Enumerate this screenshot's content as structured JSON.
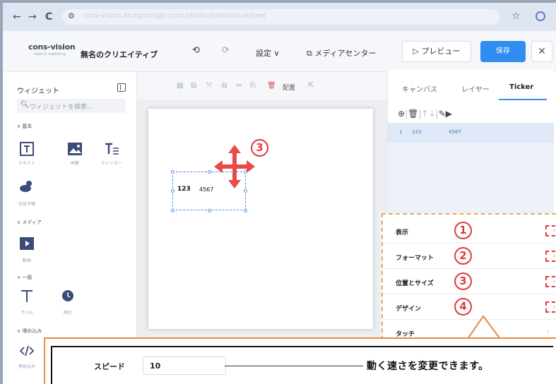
{
  "browser": {
    "nav_back": "←",
    "nav_forward": "→",
    "nav_reload": "C",
    "url": "cons-vision.imagemagic.com/studio/interactive/new"
  },
  "header": {
    "logo_text": "cons-vision",
    "logo_sub": "sales & marketing",
    "project_title": "無名のクリエイティブ",
    "undo": "⟲",
    "redo": "⟳",
    "settings_label": "設定 ∨",
    "media_center_label": "メディアセンター",
    "preview_label": "▷ プレビュー",
    "save_label": "保存",
    "close_label": "✕"
  },
  "sidebar": {
    "title": "ウィジェット",
    "search_placeholder": "ウィジェットを検索...",
    "sections": {
      "basic": "∨ 基本",
      "media": "∨ メディア",
      "general": "∨ 一般",
      "embed": "∨ 埋め込み"
    },
    "widgets": {
      "text": "テキスト",
      "image": "画像",
      "ticker": "ティッカー",
      "weather": "天気予報",
      "video": "動画",
      "label": "ラベル",
      "clock": "時計",
      "embed": "埋め込み"
    }
  },
  "toolbar": {
    "arrange_label": "配置"
  },
  "canvas": {
    "ticker_num": "123",
    "ticker_text": "4567",
    "annotation_move": "3"
  },
  "right_panel": {
    "tabs": [
      "キャンバス",
      "レイヤー",
      "Ticker"
    ],
    "active_tab": "Ticker",
    "row": {
      "index": "1",
      "col1": "123",
      "col2": "4567"
    }
  },
  "props": {
    "rows": [
      {
        "label": "表示",
        "num": "1"
      },
      {
        "label": "フォーマット",
        "num": "2"
      },
      {
        "label": "位置とサイズ",
        "num": "3"
      },
      {
        "label": "デザイン",
        "num": "4"
      },
      {
        "label": "タッチ",
        "num": ""
      }
    ]
  },
  "speed": {
    "label": "スピード",
    "value": "10",
    "note": "動く速さを変更できます。"
  },
  "colors": {
    "accent": "#2f8df0",
    "annotation_red": "#e03b3b",
    "callout_orange": "#ee8a3a"
  }
}
